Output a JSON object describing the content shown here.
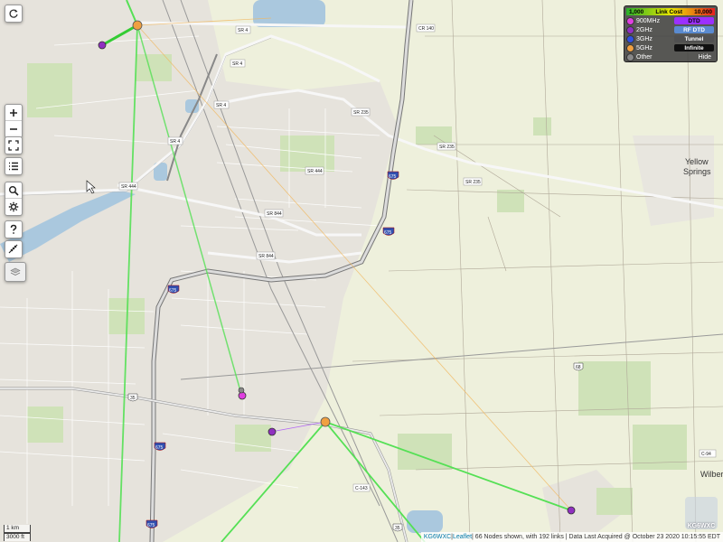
{
  "legend": {
    "cost_min": "1,000",
    "cost_label": "Link Cost",
    "cost_max": "10,000",
    "bands": [
      {
        "label": "900MHz",
        "color": "#e040e0"
      },
      {
        "label": "2GHz",
        "color": "#9030c0"
      },
      {
        "label": "3GHz",
        "color": "#3050e0"
      },
      {
        "label": "5GHz",
        "color": "#f0a040"
      },
      {
        "label": "Other",
        "color": "#888888"
      }
    ],
    "types": [
      {
        "label": "DTD",
        "bg": "#9b30ff",
        "fg": "#000000"
      },
      {
        "label": "RF DTD",
        "bg": "#5a8bd0",
        "fg": "#ffffff"
      },
      {
        "label": "Tunnel",
        "bg": "#505050",
        "fg": "#ffffff"
      },
      {
        "label": "Infinite",
        "bg": "#101010",
        "fg": "#ffffff"
      }
    ],
    "hide_label": "Hide"
  },
  "attribution": {
    "author": "KG6WXC",
    "sep1": " | ",
    "leaflet": "Leaflet",
    "summary": " | 66 Nodes shown, with 192 links  | Data Last Acquired @ October 23 2020 10:15:55 EDT"
  },
  "scale": {
    "metric": "1 km",
    "imperial": "3000 ft"
  },
  "logo_text": "KG6WXC",
  "town_labels": [
    "Yellow",
    "Springs",
    "Wilber"
  ],
  "road_labels": [
    {
      "text": "SR 4"
    },
    {
      "text": "SR 4"
    },
    {
      "text": "SR 4"
    },
    {
      "text": "SR 4"
    },
    {
      "text": "CR 140"
    },
    {
      "text": "SR 235"
    },
    {
      "text": "SR 235"
    },
    {
      "text": "SR 235"
    },
    {
      "text": "SR 444"
    },
    {
      "text": "SR 444"
    },
    {
      "text": "SR 844"
    },
    {
      "text": "SR 844"
    },
    {
      "text": "675"
    },
    {
      "text": "675"
    },
    {
      "text": "675"
    },
    {
      "text": "675"
    },
    {
      "text": "675"
    },
    {
      "text": "35"
    },
    {
      "text": "35"
    },
    {
      "text": "68"
    },
    {
      "text": "C-94"
    },
    {
      "text": "C-143"
    }
  ]
}
